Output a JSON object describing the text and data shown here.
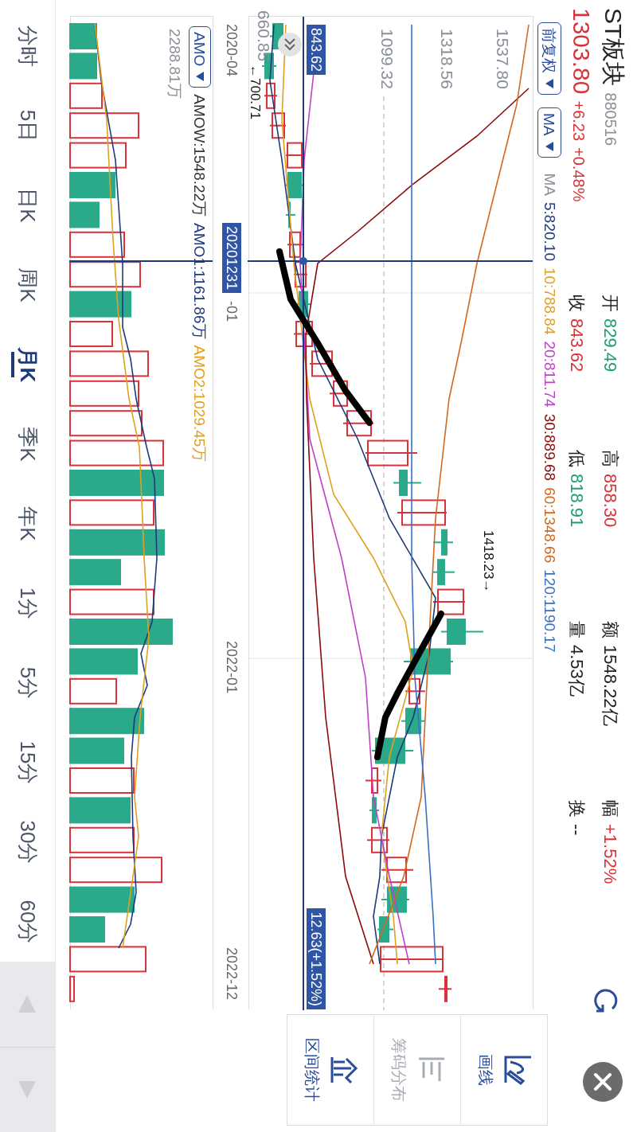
{
  "header": {
    "name": "ST板块",
    "code": "880516",
    "price": "1303.80",
    "change": "+6.23",
    "change_pct": "+0.48%",
    "color": "#d8333a"
  },
  "stats": [
    {
      "label": "开",
      "value": "829.49",
      "color": "#1f9e77"
    },
    {
      "label": "收",
      "value": "843.62",
      "color": "#d8333a"
    },
    {
      "label": "高",
      "value": "858.30",
      "color": "#d8333a"
    },
    {
      "label": "低",
      "value": "818.91",
      "color": "#1f9e77"
    },
    {
      "label": "额",
      "value": "1548.22亿",
      "color": "#222222"
    },
    {
      "label": "量",
      "value": "4.53亿",
      "color": "#222222"
    },
    {
      "label": "幅",
      "value": "+1.52%",
      "color": "#d8333a"
    },
    {
      "label": "换",
      "value": "--",
      "color": "#222222"
    }
  ],
  "toolbar": {
    "adjust_dropdown": "前复权",
    "indicator_dropdown": "MA"
  },
  "ma_legend": {
    "label": "MA",
    "items": [
      {
        "text": "5:820.10",
        "color": "#1f3a7a"
      },
      {
        "text": "10:788.84",
        "color": "#e0a020"
      },
      {
        "text": "20:811.74",
        "color": "#c040c8"
      },
      {
        "text": "30:889.68",
        "color": "#8b0a0a"
      },
      {
        "text": "60:1348.66",
        "color": "#d2691e"
      },
      {
        "text": "120:1190.17",
        "color": "#3a6fc4"
      }
    ]
  },
  "main_chart": {
    "price_labels": [
      "1537.80",
      "1318.56",
      "1099.32",
      "660.85"
    ],
    "crosshair_price": "843.62",
    "crosshair_change": "12.63(+1.52%)",
    "max_marker": "1418.23→",
    "min_marker": "←700.71"
  },
  "date_axis": {
    "labels": [
      "2020-04",
      "2022-01",
      "2022-12"
    ],
    "crosshair_date": "20201231",
    "covered_label": "-01"
  },
  "volume_chart": {
    "indicator_dropdown": "AMO",
    "legend": [
      {
        "text": "AMOW:1548.22万",
        "color": "#333333"
      },
      {
        "text": "AMO1:1161.86万",
        "color": "#1f3a7a"
      },
      {
        "text": "AMO2:1029.45万",
        "color": "#e0a020"
      }
    ],
    "max_label": "2288.81万"
  },
  "period_tabs": [
    {
      "label": "分时",
      "selected": false
    },
    {
      "label": "5日",
      "selected": false
    },
    {
      "label": "日K",
      "selected": false
    },
    {
      "label": "周K",
      "selected": false
    },
    {
      "label": "月K",
      "selected": true
    },
    {
      "label": "季K",
      "selected": false
    },
    {
      "label": "年K",
      "selected": false
    },
    {
      "label": "1分",
      "selected": false
    },
    {
      "label": "5分",
      "selected": false
    },
    {
      "label": "15分",
      "selected": false
    },
    {
      "label": "30分",
      "selected": false
    },
    {
      "label": "60分",
      "selected": false
    }
  ],
  "side_tools": [
    {
      "label": "画线",
      "kind": "draw",
      "disabled": false
    },
    {
      "label": "筹码分布",
      "kind": "chips",
      "disabled": true
    },
    {
      "label": "区间统计",
      "kind": "range",
      "disabled": false
    }
  ]
}
